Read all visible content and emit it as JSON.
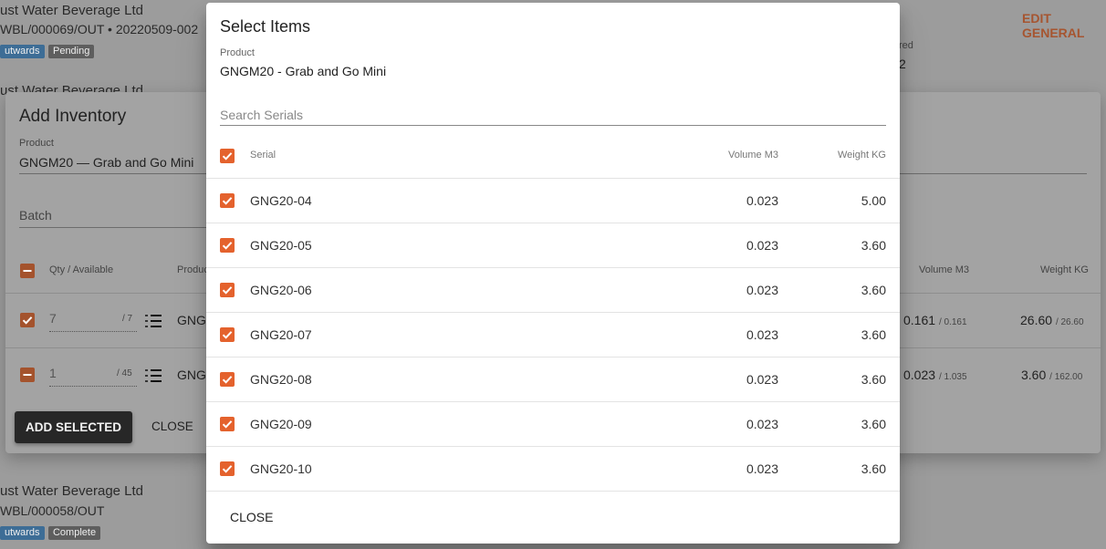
{
  "background": {
    "cards": [
      {
        "title": "ust Water Beverage Ltd",
        "subtitle": "WBL/000069/OUT • 20220509-002",
        "badges": [
          "utwards",
          "Pending"
        ]
      },
      {
        "title": "ust Water Beverage Ltd"
      },
      {
        "title": "ust Water Beverage Ltd",
        "subtitle": "WBL/000058/OUT",
        "badges": [
          "utwards",
          "Complete"
        ]
      }
    ],
    "edit_link": "EDIT GENERAL",
    "side_label": "red",
    "side_value": "2"
  },
  "inventory_dialog": {
    "title": "Add Inventory",
    "product_label": "Product",
    "product_value": "GNGM20 — Grab and Go Mini",
    "batch_placeholder": "Batch",
    "headers": {
      "qty": "Qty / Available",
      "product": "Produc",
      "volume": "Volume M3",
      "weight": "Weight KG"
    },
    "rows": [
      {
        "qty": "7",
        "available": "/ 7",
        "product": "GNGM",
        "volume": "0.161",
        "volume_total": "/ 0.161",
        "weight": "26.60",
        "weight_total": "/ 26.60"
      },
      {
        "qty": "1",
        "available": "/ 45",
        "product": "GNGM",
        "volume": "0.023",
        "volume_total": "/ 1.035",
        "weight": "3.60",
        "weight_total": "/ 162.00"
      }
    ],
    "add_selected_label": "ADD SELECTED",
    "close_label": "CLOSE"
  },
  "select_items_dialog": {
    "title": "Select Items",
    "product_label": "Product",
    "product_value": "GNGM20 - Grab and Go Mini",
    "search_placeholder": "Search Serials",
    "headers": {
      "serial": "Serial",
      "volume": "Volume M3",
      "weight": "Weight KG"
    },
    "rows": [
      {
        "serial": "GNG20-04",
        "volume": "0.023",
        "weight": "5.00",
        "checked": true
      },
      {
        "serial": "GNG20-05",
        "volume": "0.023",
        "weight": "3.60",
        "checked": true
      },
      {
        "serial": "GNG20-06",
        "volume": "0.023",
        "weight": "3.60",
        "checked": true
      },
      {
        "serial": "GNG20-07",
        "volume": "0.023",
        "weight": "3.60",
        "checked": true
      },
      {
        "serial": "GNG20-08",
        "volume": "0.023",
        "weight": "3.60",
        "checked": true
      },
      {
        "serial": "GNG20-09",
        "volume": "0.023",
        "weight": "3.60",
        "checked": true
      },
      {
        "serial": "GNG20-10",
        "volume": "0.023",
        "weight": "3.60",
        "checked": true
      }
    ],
    "close_label": "CLOSE"
  },
  "colors": {
    "accent": "#E4622D",
    "dark_button": "#272727"
  }
}
